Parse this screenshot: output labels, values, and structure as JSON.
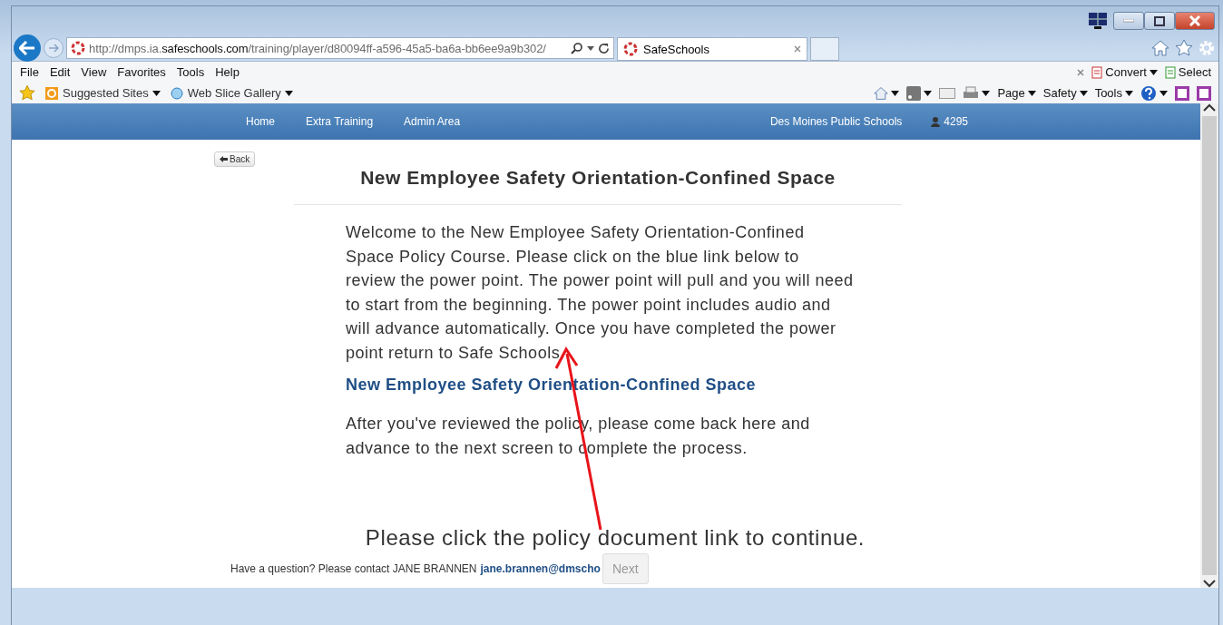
{
  "browser": {
    "address": "http://dmps.ia.**safeschools.com**/training/player/d80094ff-a596-45a5-ba6a-bb6ee9a9b302/",
    "tabs": [
      {
        "title": "SafeSchools",
        "selected": true
      }
    ],
    "menu": [
      "File",
      "Edit",
      "View",
      "Favorites",
      "Tools",
      "Help"
    ],
    "favorites": [
      "Suggested Sites",
      "Web Slice Gallery"
    ],
    "addon_buttons": [
      "Convert",
      "Select"
    ],
    "command_bar": [
      "Page",
      "Safety",
      "Tools"
    ]
  },
  "nav": {
    "links": [
      "Home",
      "Extra Training",
      "Admin Area"
    ],
    "organization": "Des Moines Public Schools",
    "user": "4295"
  },
  "back_button": "Back",
  "title": "New Employee Safety Orientation-Confined Space",
  "intro": "Welcome to the New Employee Safety Orientation-Confined Space Policy Course. Please click on the blue link below to review the power point. The power point will pull and you will need to start from the beginning. The power point includes audio and will advance automatically. Once you have completed the power point return to Safe Schools.",
  "link": "New Employee Safety Orientation-Confined Space",
  "followup": "After you've reviewed the policy, please come back here and advance to the next screen to complete the process.",
  "notice": "Please click the policy document link to continue.",
  "footer": {
    "text": "Have a question? Please contact JANE BRANNEN",
    "email": "jane.brannen@dmscho"
  },
  "next_button": {
    "label": "Next",
    "disabled": true
  }
}
